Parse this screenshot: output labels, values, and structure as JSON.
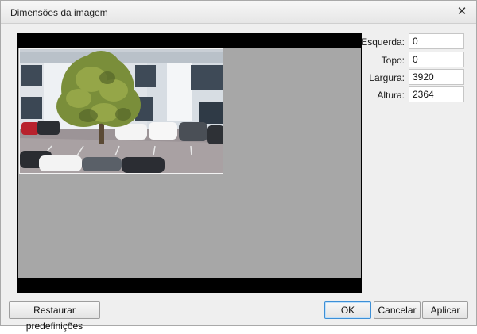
{
  "window": {
    "title": "Dimensões da imagem",
    "close_glyph": "✕"
  },
  "fields": [
    {
      "label": "Esquerda:",
      "value": "0"
    },
    {
      "label": "Topo:",
      "value": "0"
    },
    {
      "label": "Largura:",
      "value": "3920"
    },
    {
      "label": "Altura:",
      "value": "2364"
    }
  ],
  "buttons": {
    "reset": "Restaurar predefinições",
    "ok": "OK",
    "cancel": "Cancelar",
    "apply": "Aplicar"
  },
  "colors": {
    "letterbox": "#000000",
    "canvas": "#a7a7a7",
    "accent": "#3d8fd6"
  }
}
